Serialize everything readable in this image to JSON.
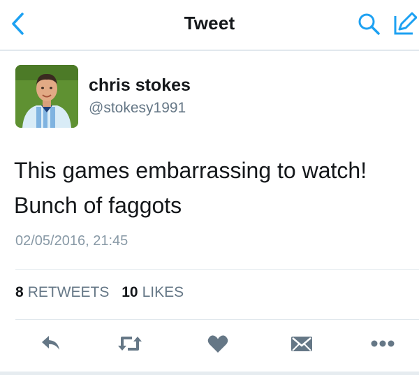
{
  "header": {
    "title": "Tweet",
    "back_icon": "chevron-left-icon",
    "search_icon": "search-icon",
    "compose_icon": "compose-icon"
  },
  "user": {
    "name": "chris stokes",
    "handle": "@stokesy1991",
    "avatar_icon": "profile-photo"
  },
  "tweet": {
    "lines": [
      "This games embarrassing to watch!",
      "Bunch of faggots"
    ],
    "timestamp": "02/05/2016, 21:45"
  },
  "stats": {
    "retweets_count": "8",
    "retweets_label": "RETWEETS",
    "likes_count": "10",
    "likes_label": "LIKES"
  },
  "actions": [
    {
      "name": "reply",
      "icon": "reply-icon"
    },
    {
      "name": "retweet",
      "icon": "retweet-icon"
    },
    {
      "name": "like",
      "icon": "heart-icon"
    },
    {
      "name": "direct-message",
      "icon": "envelope-icon"
    },
    {
      "name": "more",
      "icon": "more-icon"
    }
  ],
  "colors": {
    "accent": "#1da1f2",
    "icon_gray": "#657786",
    "text": "#14171a",
    "secondary_text": "#657786",
    "divider": "#e1e8ed"
  }
}
